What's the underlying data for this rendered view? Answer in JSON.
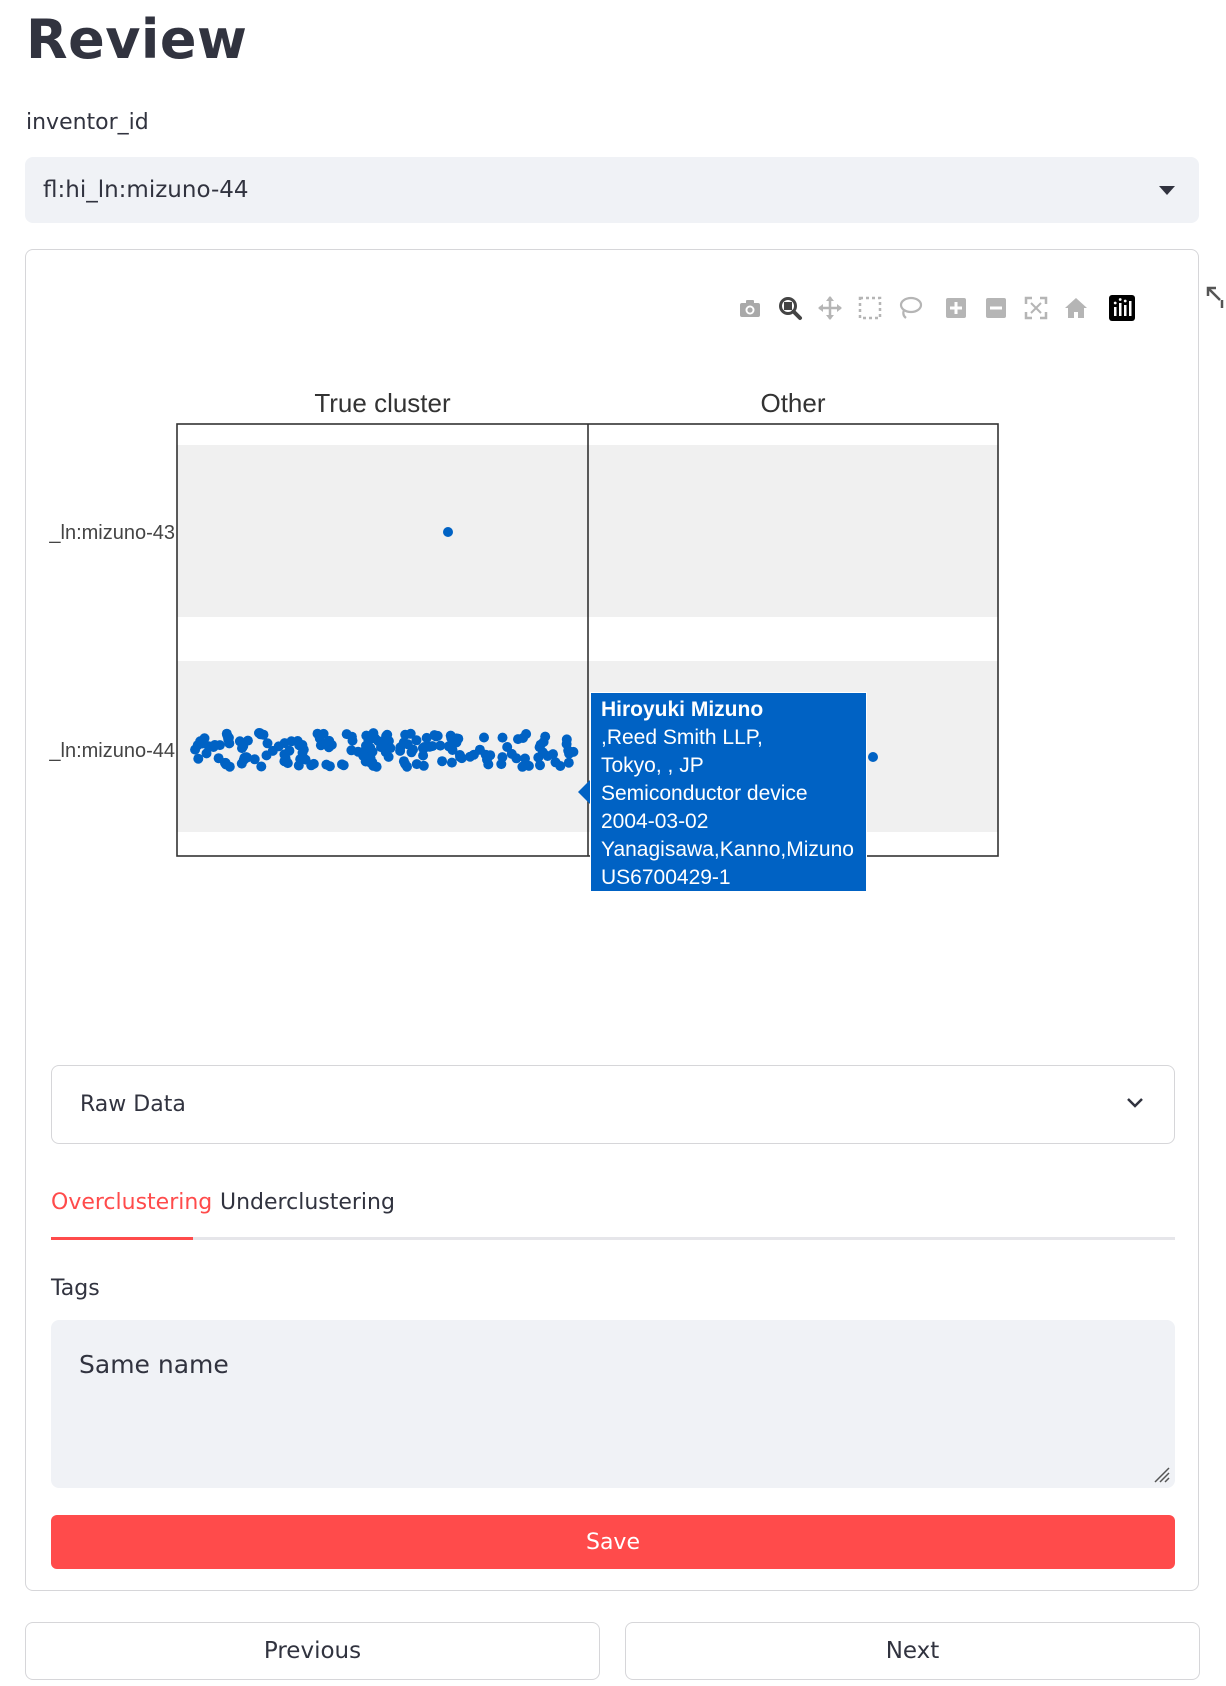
{
  "page": {
    "title": "Review"
  },
  "selector": {
    "label": "inventor_id",
    "value": "fl:hi_ln:mizuno-44"
  },
  "modebar": {
    "icons": [
      "camera-icon",
      "zoom-icon",
      "pan-icon",
      "box-select-icon",
      "lasso-select-icon",
      "zoom-in-icon",
      "zoom-out-icon",
      "autoscale-icon",
      "reset-axes-icon",
      "plotly-logo-icon"
    ]
  },
  "chart_data": {
    "type": "scatter",
    "facets": [
      "True cluster",
      "Other"
    ],
    "y_categories": [
      "_ln:mizuno-43",
      "_ln:mizuno-44"
    ],
    "grid": false,
    "marker_color": "#0062c4",
    "series": [
      {
        "facet": "True cluster",
        "category": "_ln:mizuno-43",
        "count": 1
      },
      {
        "facet": "True cluster",
        "category": "_ln:mizuno-44",
        "count": 180
      },
      {
        "facet": "Other",
        "category": "_ln:mizuno-44",
        "count": 1
      }
    ],
    "hover": {
      "name": "Hiroyuki Mizuno",
      "firm": ",Reed Smith LLP,",
      "location": "Tokyo, , JP",
      "title": "Semiconductor device",
      "date": "2004-03-02",
      "coinventors": "Yanagisawa,Kanno,Mizuno",
      "patent": "US6700429-1"
    }
  },
  "expander": {
    "label": "Raw Data"
  },
  "tabs": [
    {
      "label": "Overclustering",
      "active": true
    },
    {
      "label": "Underclustering",
      "active": false
    }
  ],
  "tags": {
    "label": "Tags",
    "value": "Same name"
  },
  "buttons": {
    "save": "Save",
    "previous": "Previous",
    "next": "Next"
  },
  "colors": {
    "accent": "#ff4b4b",
    "marker": "#0062c4",
    "input_bg": "#f0f2f6"
  }
}
